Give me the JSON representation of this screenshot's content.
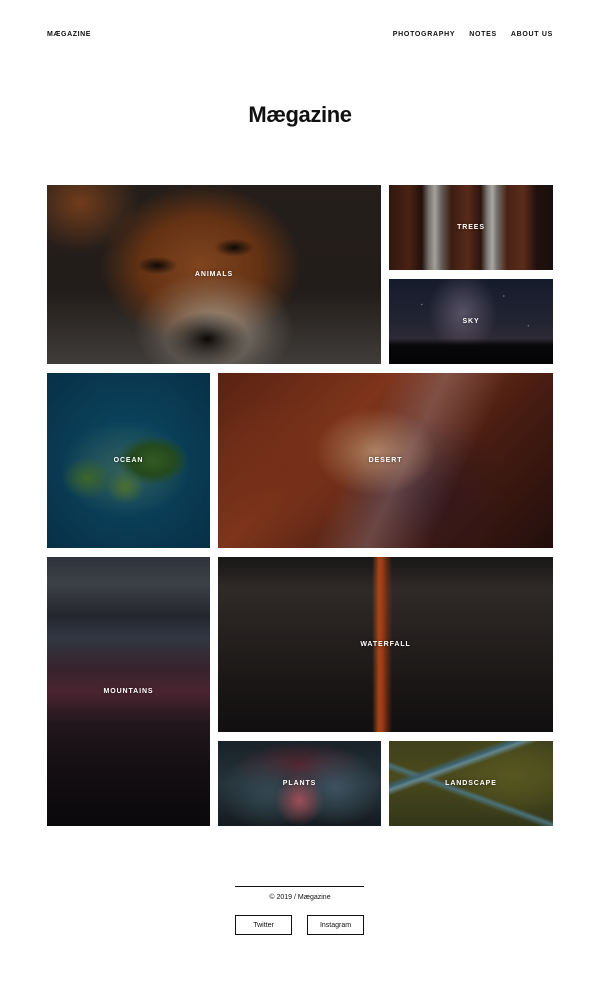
{
  "header": {
    "logo": "MÆGAZINE",
    "nav": [
      {
        "label": "PHOTOGRAPHY"
      },
      {
        "label": "NOTES"
      },
      {
        "label": "ABOUT US"
      }
    ]
  },
  "title": "Mægazine",
  "gallery": {
    "tiles": [
      {
        "label": "ANIMALS"
      },
      {
        "label": "TREES"
      },
      {
        "label": "SKY"
      },
      {
        "label": "OCEAN"
      },
      {
        "label": "DESERT"
      },
      {
        "label": "MOUNTAINS"
      },
      {
        "label": "WATERFALL"
      },
      {
        "label": "PLANTS"
      },
      {
        "label": "LANDSCAPE"
      }
    ]
  },
  "footer": {
    "copyright": "© 2019 / Mægazine",
    "social": [
      {
        "label": "Twitter"
      },
      {
        "label": "Instagram"
      }
    ]
  }
}
